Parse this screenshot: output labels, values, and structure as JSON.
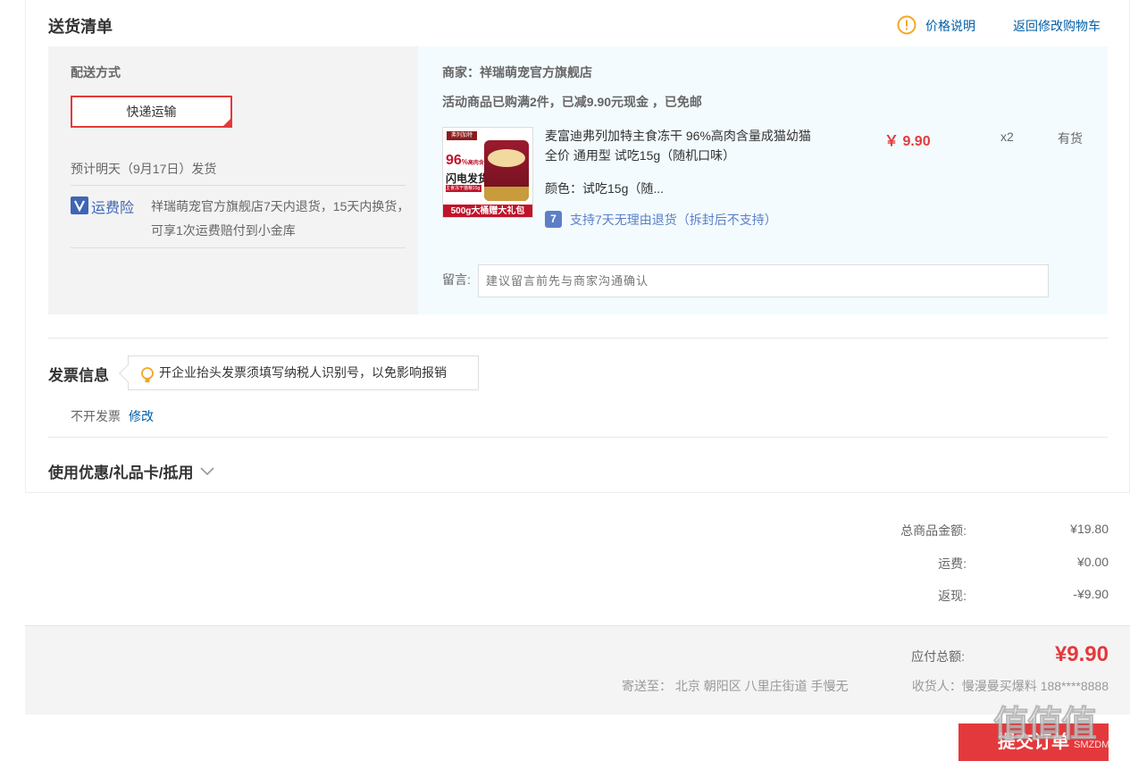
{
  "delivery": {
    "title": "送货清单",
    "price_note": "价格说明",
    "back_to_cart": "返回修改购物车",
    "method_label": "配送方式",
    "method_option": "快递运输",
    "ship_time": "预计明天（9月17日）发货",
    "insurance_badge": "运费险",
    "insurance_text": "祥瑞萌宠官方旗舰店7天内退货，15天内换货，可享1次运费赔付到小金库"
  },
  "merchant": {
    "label": "商家：祥瑞萌宠官方旗舰店",
    "promo": "活动商品已购满2件，已减9.90元现金 ，已免邮"
  },
  "product": {
    "name": "麦富迪弗列加特主食冻干 96%高肉含量成猫幼猫 全价 通用型 试吃15g（随机口味）",
    "price": "￥ 9.90",
    "qty": "x2",
    "stock": "有货",
    "color": "颜色：试吃15g（随...",
    "return_policy": "支持7天无理由退货（拆封后不支持）",
    "image_texts": {
      "brand": "弗列加特",
      "percent": "96",
      "percent_suffix": "%",
      "meat_label": "高肉含量",
      "flash": "闪电发货",
      "sub": "主食冻干猫粮15g",
      "banner": "500g大桶赠大礼包"
    }
  },
  "note": {
    "label": "留言:",
    "placeholder": "建议留言前先与商家沟通确认"
  },
  "invoice": {
    "title": "发票信息",
    "tip": "开企业抬头发票须填写纳税人识别号，以免影响报销",
    "status": "不开发票",
    "edit": "修改"
  },
  "coupon": {
    "title": "使用优惠/礼品卡/抵用"
  },
  "summary": {
    "goods_label": "总商品金额:",
    "goods_value": "¥19.80",
    "freight_label": "运费:",
    "freight_value": "¥0.00",
    "cashback_label": "返现:",
    "cashback_value": "-¥9.90"
  },
  "footer": {
    "total_label": "应付总额:",
    "total_value": "¥9.90",
    "ship_to": "寄送至： 北京 朝阳区 八里庄街道 手慢无",
    "receiver": "收货人：慢漫曼买爆料 188****8888",
    "submit": "提交订单"
  },
  "watermark": {
    "text": "值值值",
    "sub": "SMZDM.COM"
  },
  "colors": {
    "accent": "#e4393c",
    "link": "#005ea7",
    "warn": "#f5a623"
  }
}
